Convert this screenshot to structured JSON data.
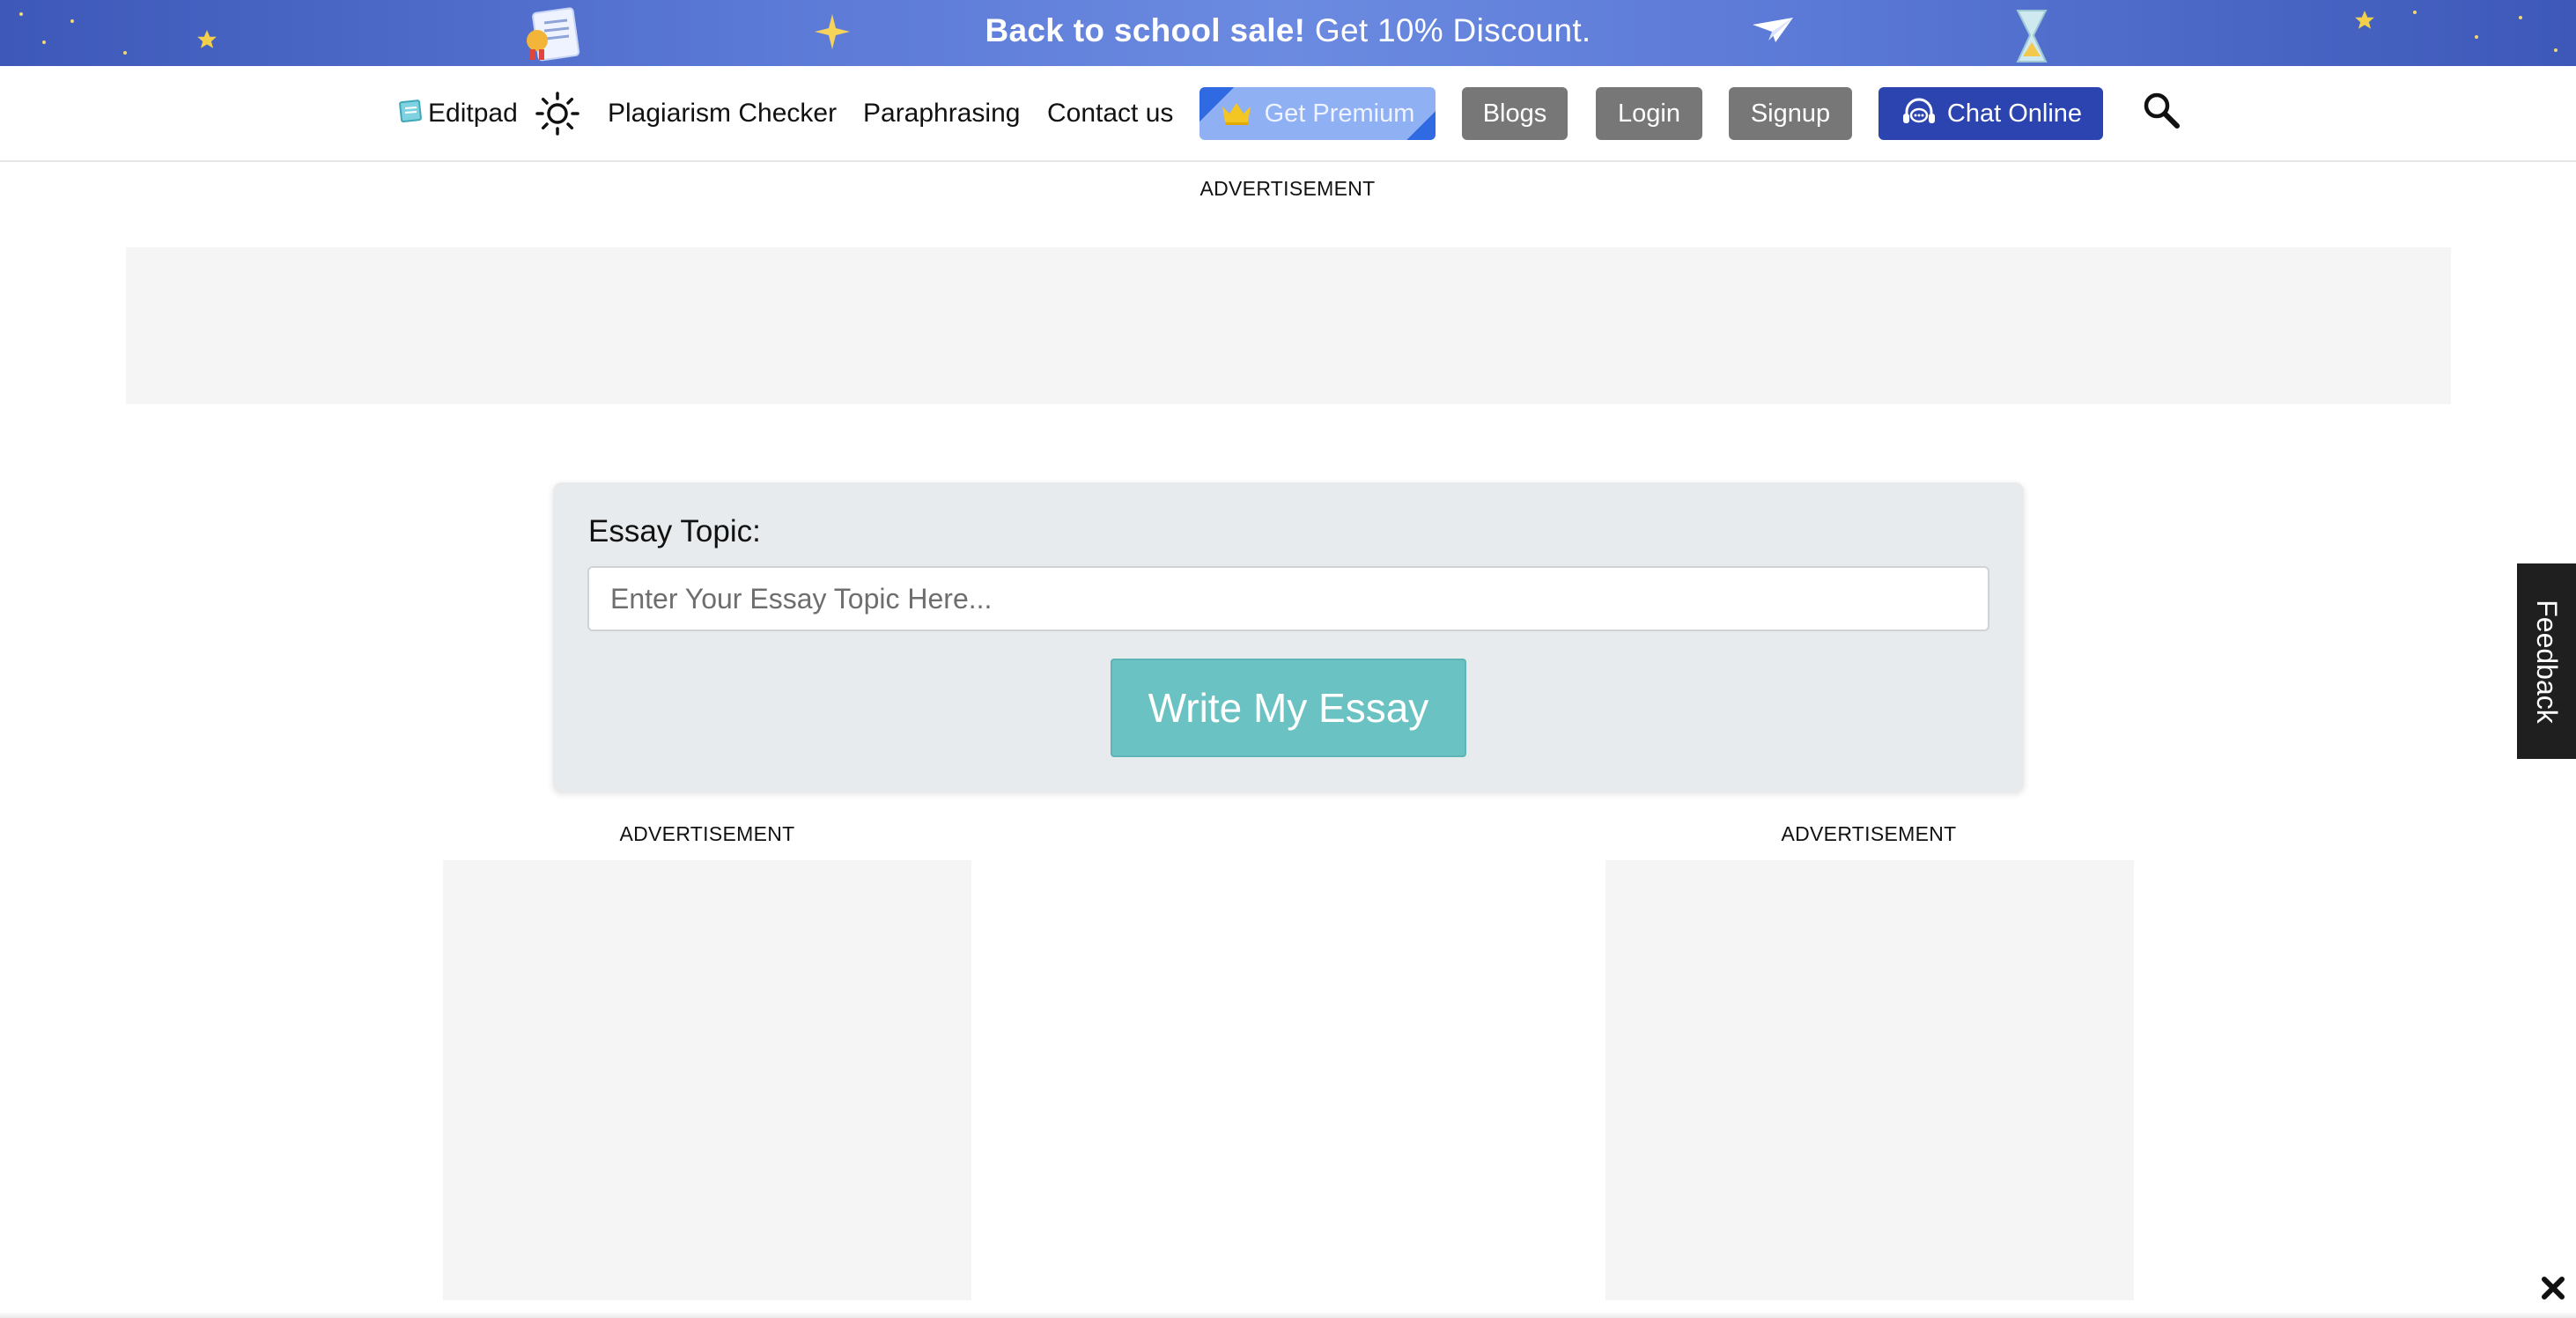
{
  "promo": {
    "strong_text": "Back to school sale!",
    "rest_text": " Get 10% Discount."
  },
  "nav": {
    "logo_label": "Editpad",
    "links": {
      "plagiarism": "Plagiarism Checker",
      "paraphrasing": "Paraphrasing",
      "contact": "Contact us"
    },
    "buttons": {
      "premium": "Get Premium",
      "blogs": "Blogs",
      "login": "Login",
      "signup": "Signup",
      "chat": "Chat Online"
    }
  },
  "ads": {
    "top_label": "ADVERTISEMENT",
    "left_label": "ADVERTISEMENT",
    "right_label": "ADVERTISEMENT"
  },
  "essay_form": {
    "label": "Essay Topic:",
    "input_value": "",
    "input_placeholder": "Enter Your Essay Topic Here...",
    "submit_label": "Write My Essay"
  },
  "feedback": {
    "label": "Feedback"
  },
  "icons": {
    "logo": "notepad-icon",
    "theme": "sun-icon",
    "premium": "crown-icon",
    "chat": "headset-chat-icon",
    "search": "search-icon",
    "close": "close-icon"
  },
  "colors": {
    "promo_bg": "#4f6cc9",
    "premium_btn": "#8fb0f3",
    "gray_btn": "#777777",
    "chat_btn": "#2b44b0",
    "submit_btn": "#6ac2c3",
    "card_bg": "#e8ebed",
    "ad_bg": "#f5f5f5",
    "feedback_bg": "#1f1f1f"
  }
}
